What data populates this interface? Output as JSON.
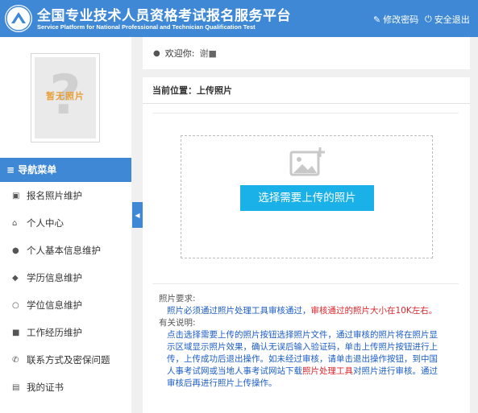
{
  "header": {
    "title": "全国专业技术人员资格考试报名服务平台",
    "subtitle": "Service Platform for National Professional and Technician Qualification Test",
    "change_password": "修改密码",
    "logout": "安全退出"
  },
  "sidebar": {
    "avatar_text": "暂无照片",
    "nav_header": "导航菜单",
    "items": [
      {
        "label": "报名照片维护",
        "icon": "image-icon"
      },
      {
        "label": "个人中心",
        "icon": "home-icon"
      },
      {
        "label": "个人基本信息维护",
        "icon": "user-icon"
      },
      {
        "label": "学历信息维护",
        "icon": "graduation-cap-icon"
      },
      {
        "label": "学位信息维护",
        "icon": "medal-icon"
      },
      {
        "label": "工作经历维护",
        "icon": "briefcase-icon"
      },
      {
        "label": "联系方式及密保问题",
        "icon": "phone-icon"
      },
      {
        "label": "我的证书",
        "icon": "certificate-icon"
      }
    ]
  },
  "welcome": {
    "label": "欢迎你:",
    "name": "谢■"
  },
  "main": {
    "breadcrumb": "当前位置：上传照片",
    "upload_button": "选择需要上传的照片",
    "notes": {
      "req_heading": "照片要求:",
      "req_text_1": "照片必须通过照片处理工具审核通过，",
      "req_text_red": "审核通过的照片大小在10K左右。",
      "info_heading": "有关说明:",
      "info_text_1": "点击选择需要上传的照片按钮选择照片文件，通过审核的照片将在照片显示区域显示照片效果，确认无误后输入验证码，单击上传照片按钮进行上传，上传成功后退出操作。如未经过审核，请单击退出操作按钮，到中国人事考试网或当地人事考试网站下载",
      "info_text_red": "照片处理工具",
      "info_text_2": "对照片进行审核。通过审核后再进行照片上传操作。"
    }
  },
  "colors": {
    "primary": "#3f88d6",
    "button": "#1ab0e8",
    "warning": "#e0262b",
    "link_text": "#1d5ec7"
  }
}
